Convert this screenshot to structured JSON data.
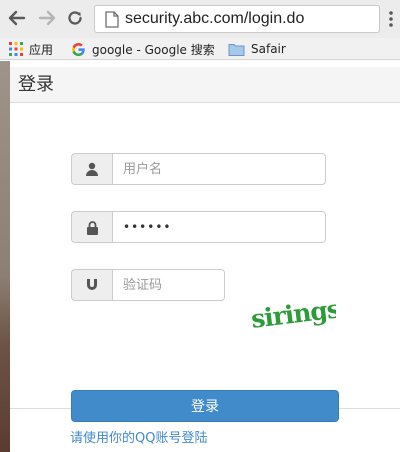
{
  "browser": {
    "url": "security.abc.com/login.do",
    "bookmarks": [
      {
        "label": "应用"
      },
      {
        "label": "google - Google 搜索"
      },
      {
        "label": "Safair"
      }
    ]
  },
  "panel": {
    "title": "登录"
  },
  "form": {
    "username_placeholder": "用户名",
    "password_value": "••••••",
    "captcha_placeholder": "验证码",
    "captcha_image_text": "sirings",
    "login_label": "登录"
  },
  "footer": {
    "qq_login_label": "请使用你的QQ账号登陆"
  },
  "colors": {
    "primary": "#428bca",
    "captcha": "#2e9b3a"
  }
}
